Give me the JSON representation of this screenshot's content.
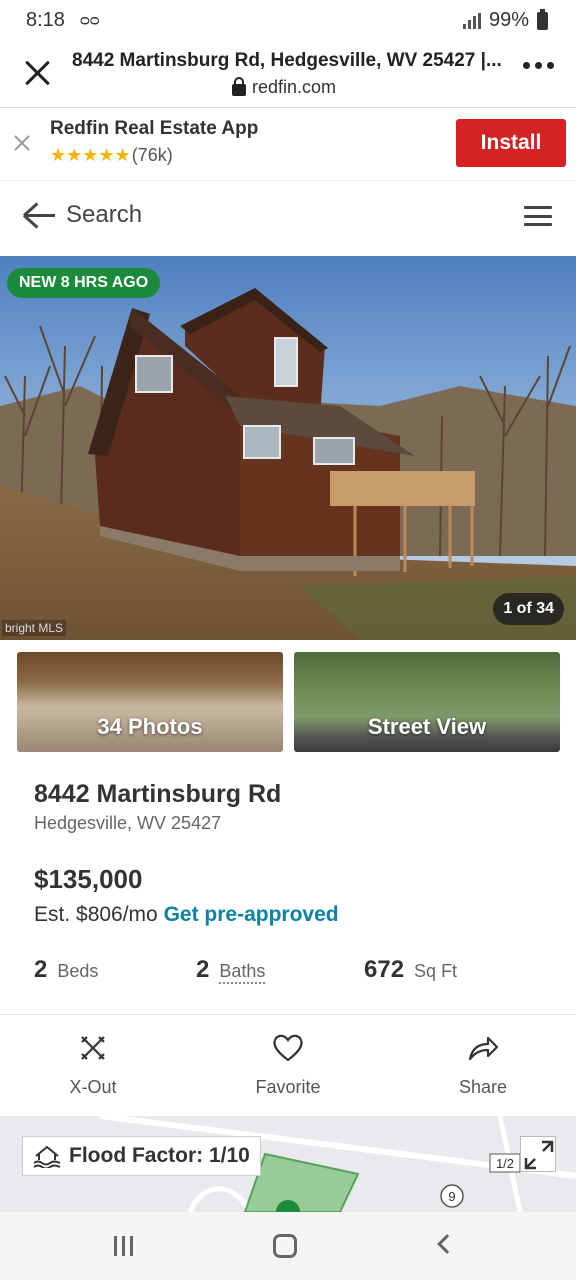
{
  "status_bar": {
    "time": "8:18",
    "voicemail_icon": "voicemail-icon",
    "battery": "99%"
  },
  "browser": {
    "title": "8442 Martinsburg Rd, Hedgesville, WV 25427 |...",
    "url": "redfin.com"
  },
  "app_banner": {
    "app_name": "Redfin Real Estate App",
    "stars": "★★★★★",
    "rating_count": "(76k)",
    "install_label": "Install",
    "install_color": "#d32323"
  },
  "nav": {
    "search_label": "Search"
  },
  "hero": {
    "badge": "NEW 8 HRS AGO",
    "badge_color": "#1b8a3a",
    "photo_counter": "1 of 34",
    "mls_logo": "bright MLS"
  },
  "thumbnails": {
    "photos_label": "34 Photos",
    "street_view_label": "Street View"
  },
  "listing": {
    "street": "8442 Martinsburg Rd",
    "city_state_zip": "Hedgesville, WV 25427",
    "price": "$135,000",
    "est_payment": "Est. $806/mo",
    "preapproved_link": "Get pre-approved",
    "link_color": "#0c82a3",
    "beds_num": "2",
    "beds_label": "Beds",
    "baths_num": "2",
    "baths_label": "Baths",
    "sqft_num": "672",
    "sqft_label": "Sq Ft"
  },
  "actions": {
    "xout_label": "X-Out",
    "favorite_label": "Favorite",
    "share_label": "Share"
  },
  "map": {
    "flood_factor": "Flood Factor: 1/10",
    "scale_label": "1/2",
    "road_marker": "9"
  }
}
